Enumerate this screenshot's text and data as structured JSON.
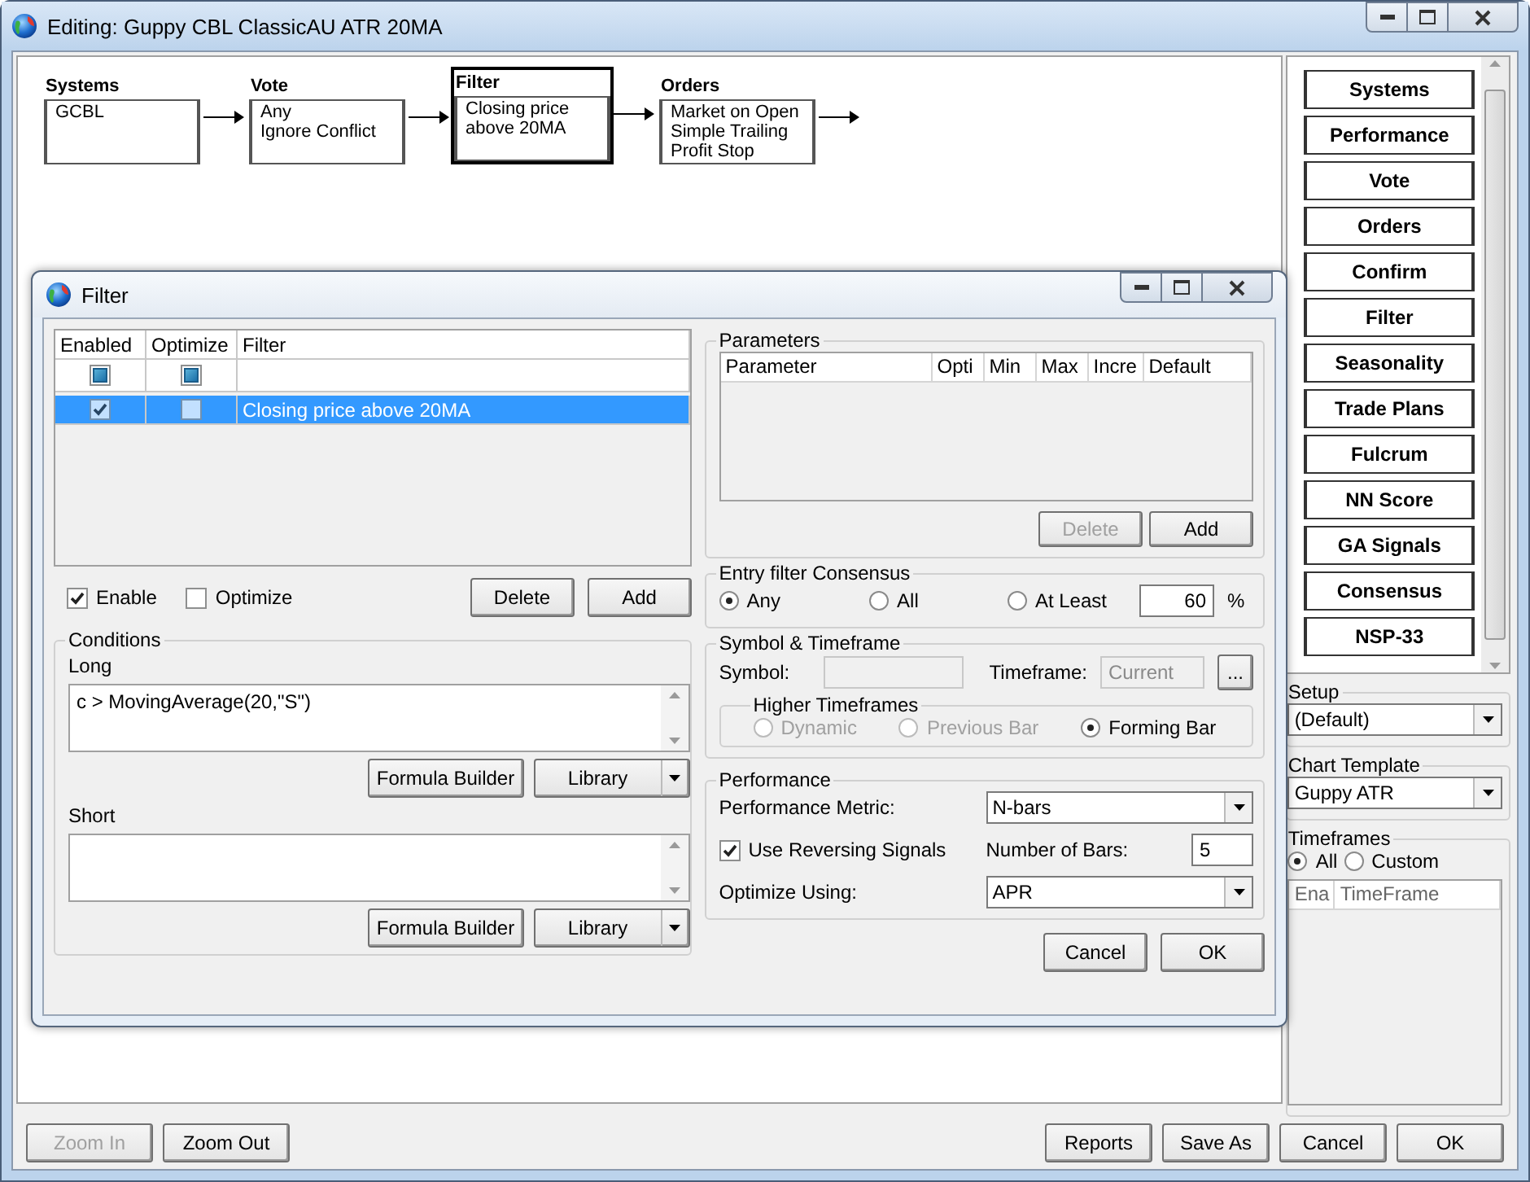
{
  "window": {
    "title": "Editing: Guppy CBL ClassicAU ATR 20MA"
  },
  "flow": [
    {
      "name": "Systems",
      "lines": [
        "GCBL"
      ],
      "selected": false
    },
    {
      "name": "Vote",
      "lines": [
        "Any",
        "Ignore Conflict"
      ],
      "selected": false
    },
    {
      "name": "Filter",
      "lines": [
        "Closing price",
        "above 20MA"
      ],
      "selected": true
    },
    {
      "name": "Orders",
      "lines": [
        "Market on Open",
        "Simple Trailing",
        "Profit Stop"
      ],
      "selected": false
    }
  ],
  "side_buttons": [
    "Systems",
    "Performance",
    "Vote",
    "Orders",
    "Confirm",
    "Filter",
    "Seasonality",
    "Trade Plans",
    "Fulcrum",
    "NN Score",
    "GA Signals",
    "Consensus",
    "NSP-33"
  ],
  "setup": {
    "label": "Setup",
    "value": "(Default)"
  },
  "chart_template": {
    "label": "Chart Template",
    "value": "Guppy ATR"
  },
  "timeframes": {
    "label": "Timeframes",
    "options": [
      {
        "label": "All",
        "selected": true
      },
      {
        "label": "Custom",
        "selected": false
      }
    ],
    "columns": [
      "Ena",
      "TimeFrame"
    ]
  },
  "bottom_left": [
    {
      "label": "Zoom In",
      "disabled": true
    },
    {
      "label": "Zoom Out",
      "disabled": false
    }
  ],
  "bottom_right": [
    {
      "label": "Reports",
      "disabled": false
    },
    {
      "label": "Save As",
      "disabled": false
    },
    {
      "label": "Cancel",
      "disabled": false
    },
    {
      "label": "OK",
      "disabled": false
    }
  ],
  "dialog": {
    "title": "Filter",
    "filter_table": {
      "columns": [
        "Enabled",
        "Optimize",
        "Filter"
      ],
      "all_row": {
        "enabled_indeterminate": true,
        "optimize_indeterminate": true
      },
      "rows": [
        {
          "enabled": true,
          "optimize": false,
          "filter": "Closing price above 20MA",
          "selected": true
        }
      ]
    },
    "enable": {
      "label": "Enable",
      "checked": true
    },
    "optimize": {
      "label": "Optimize",
      "checked": false
    },
    "list_buttons": [
      {
        "label": "Delete",
        "disabled": false
      },
      {
        "label": "Add",
        "disabled": false
      }
    ],
    "conditions": {
      "title": "Conditions",
      "long": {
        "label": "Long",
        "value": "c > MovingAverage(20,\"S\")",
        "buttons": [
          "Formula Builder",
          "Library"
        ]
      },
      "short": {
        "label": "Short",
        "buttons": [
          "Formula Builder",
          "Library"
        ]
      }
    },
    "parameters": {
      "title": "Parameters",
      "columns": [
        "Parameter",
        "Opti",
        "Min",
        "Max",
        "Incre",
        "Default"
      ],
      "buttons": [
        {
          "label": "Delete",
          "disabled": true
        },
        {
          "label": "Add",
          "disabled": false
        }
      ]
    },
    "consensus": {
      "title": "Entry filter Consensus",
      "options": [
        {
          "label": "Any",
          "selected": true
        },
        {
          "label": "All",
          "selected": false
        },
        {
          "label": "At Least",
          "selected": false
        }
      ],
      "percent": "60",
      "unit": "%"
    },
    "symbol_tf": {
      "title": "Symbol & Timeframe",
      "symbol_label": "Symbol:",
      "timeframe_label": "Timeframe:",
      "timeframe_value": "Current",
      "browse": "...",
      "higher": {
        "title": "Higher Timeframes",
        "options": [
          {
            "label": "Dynamic",
            "selected": false,
            "disabled": true
          },
          {
            "label": "Previous Bar",
            "selected": false,
            "disabled": true
          },
          {
            "label": "Forming Bar",
            "selected": true,
            "disabled": false
          }
        ]
      }
    },
    "performance": {
      "title": "Performance",
      "metric": {
        "label": "Performance Metric:",
        "value": "N-bars"
      },
      "reversing": {
        "label": "Use Reversing Signals",
        "checked": true
      },
      "bars": {
        "label": "Number of Bars:",
        "value": "5"
      },
      "optimize_using": {
        "label": "Optimize Using:",
        "value": "APR"
      }
    },
    "buttons": [
      {
        "label": "Cancel"
      },
      {
        "label": "OK"
      }
    ]
  }
}
